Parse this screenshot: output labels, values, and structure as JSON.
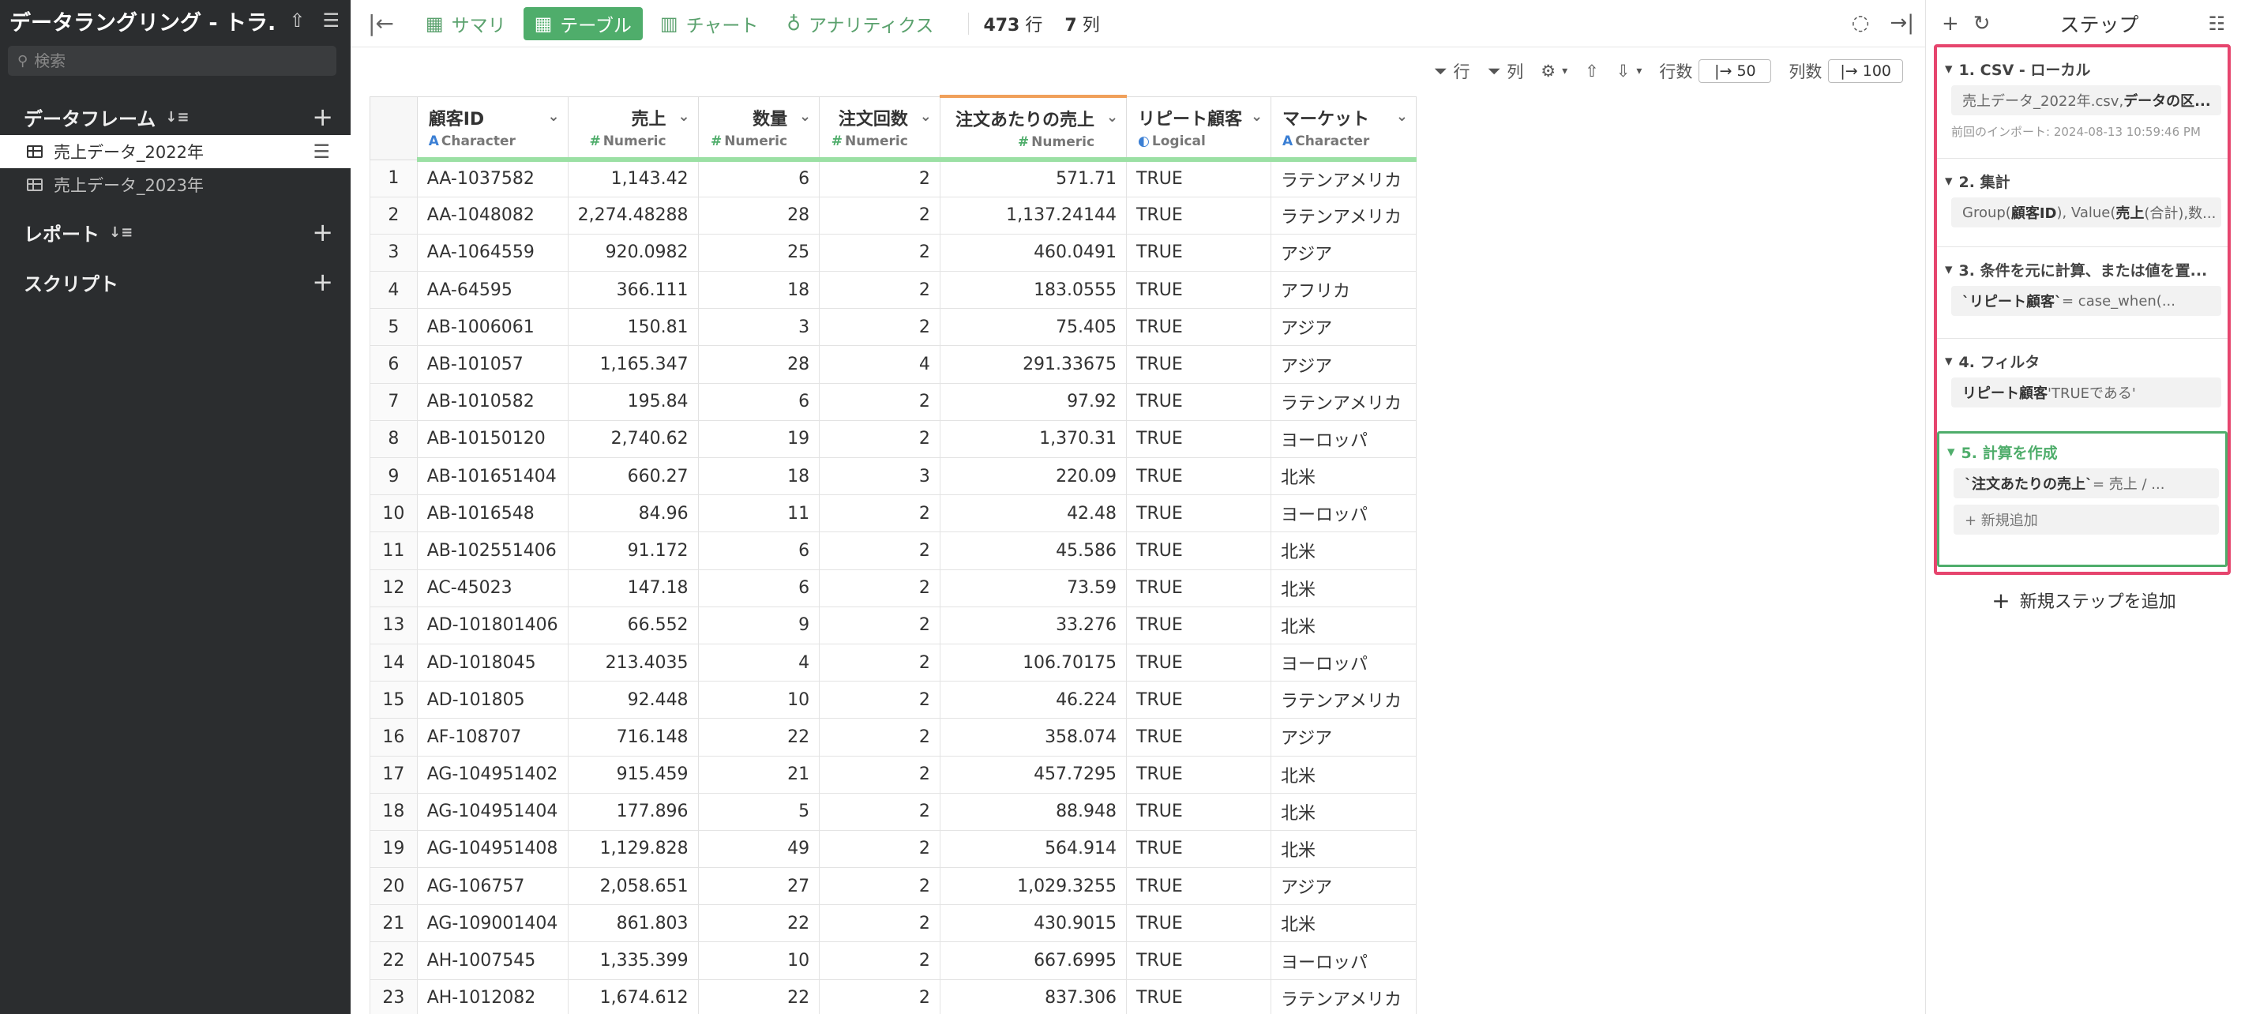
{
  "sidebar": {
    "title": "データラングリング - トラ...",
    "search_placeholder": "検索",
    "sections": {
      "dataframe": "データフレーム",
      "report": "レポート",
      "script": "スクリプト"
    },
    "dataframes": [
      "売上データ_2022年",
      "売上データ_2023年"
    ]
  },
  "toolbar": {
    "tabs": [
      "サマリ",
      "テーブル",
      "チャート",
      "アナリティクス"
    ],
    "rows_count": "473",
    "rows_unit": "行",
    "cols_count": "7",
    "cols_unit": "列"
  },
  "subbar": {
    "row_filter": "行",
    "col_filter": "列",
    "rows_label": "行数",
    "rows_value": "50",
    "cols_label": "列数",
    "cols_value": "100"
  },
  "table": {
    "columns": [
      {
        "name": "顧客ID",
        "type": "Character",
        "mark": "A"
      },
      {
        "name": "売上",
        "type": "Numeric",
        "mark": "#"
      },
      {
        "name": "数量",
        "type": "Numeric",
        "mark": "#"
      },
      {
        "name": "注文回数",
        "type": "Numeric",
        "mark": "#"
      },
      {
        "name": "注文あたりの売上",
        "type": "Numeric",
        "mark": "#"
      },
      {
        "name": "リピート顧客",
        "type": "Logical",
        "mark": "◐"
      },
      {
        "name": "マーケット",
        "type": "Character",
        "mark": "A"
      }
    ],
    "rows": [
      [
        "1",
        "AA-1037582",
        "1,143.42",
        "6",
        "2",
        "571.71",
        "TRUE",
        "ラテンアメリカ"
      ],
      [
        "2",
        "AA-1048082",
        "2,274.48288",
        "28",
        "2",
        "1,137.24144",
        "TRUE",
        "ラテンアメリカ"
      ],
      [
        "3",
        "AA-1064559",
        "920.0982",
        "25",
        "2",
        "460.0491",
        "TRUE",
        "アジア"
      ],
      [
        "4",
        "AA-64595",
        "366.111",
        "18",
        "2",
        "183.0555",
        "TRUE",
        "アフリカ"
      ],
      [
        "5",
        "AB-1006061",
        "150.81",
        "3",
        "2",
        "75.405",
        "TRUE",
        "アジア"
      ],
      [
        "6",
        "AB-101057",
        "1,165.347",
        "28",
        "4",
        "291.33675",
        "TRUE",
        "アジア"
      ],
      [
        "7",
        "AB-1010582",
        "195.84",
        "6",
        "2",
        "97.92",
        "TRUE",
        "ラテンアメリカ"
      ],
      [
        "8",
        "AB-10150120",
        "2,740.62",
        "19",
        "2",
        "1,370.31",
        "TRUE",
        "ヨーロッパ"
      ],
      [
        "9",
        "AB-101651404",
        "660.27",
        "18",
        "3",
        "220.09",
        "TRUE",
        "北米"
      ],
      [
        "10",
        "AB-1016548",
        "84.96",
        "11",
        "2",
        "42.48",
        "TRUE",
        "ヨーロッパ"
      ],
      [
        "11",
        "AB-102551406",
        "91.172",
        "6",
        "2",
        "45.586",
        "TRUE",
        "北米"
      ],
      [
        "12",
        "AC-45023",
        "147.18",
        "6",
        "2",
        "73.59",
        "TRUE",
        "北米"
      ],
      [
        "13",
        "AD-101801406",
        "66.552",
        "9",
        "2",
        "33.276",
        "TRUE",
        "北米"
      ],
      [
        "14",
        "AD-1018045",
        "213.4035",
        "4",
        "2",
        "106.70175",
        "TRUE",
        "ヨーロッパ"
      ],
      [
        "15",
        "AD-101805",
        "92.448",
        "10",
        "2",
        "46.224",
        "TRUE",
        "ラテンアメリカ"
      ],
      [
        "16",
        "AF-108707",
        "716.148",
        "22",
        "2",
        "358.074",
        "TRUE",
        "アジア"
      ],
      [
        "17",
        "AG-104951402",
        "915.459",
        "21",
        "2",
        "457.7295",
        "TRUE",
        "北米"
      ],
      [
        "18",
        "AG-104951404",
        "177.896",
        "5",
        "2",
        "88.948",
        "TRUE",
        "北米"
      ],
      [
        "19",
        "AG-104951408",
        "1,129.828",
        "49",
        "2",
        "564.914",
        "TRUE",
        "北米"
      ],
      [
        "20",
        "AG-106757",
        "2,058.651",
        "27",
        "2",
        "1,029.3255",
        "TRUE",
        "アジア"
      ],
      [
        "21",
        "AG-109001404",
        "861.803",
        "22",
        "2",
        "430.9015",
        "TRUE",
        "北米"
      ],
      [
        "22",
        "AH-1007545",
        "1,335.399",
        "10",
        "2",
        "667.6995",
        "TRUE",
        "ヨーロッパ"
      ],
      [
        "23",
        "AH-1012082",
        "1,674.612",
        "22",
        "2",
        "837.306",
        "TRUE",
        "ラテンアメリカ"
      ]
    ]
  },
  "steps": {
    "title": "ステップ",
    "items": [
      {
        "name": "1. CSV - ローカル",
        "body_plain": "売上データ_2022年.csv, ",
        "body_bold": "データの区...",
        "note": "前回のインポート: 2024-08-13 10:59:46 PM"
      },
      {
        "name": "2. 集計",
        "body_html_parts": [
          "Group(",
          "顧客ID",
          "), Value(",
          "売上",
          " (合計),数..."
        ]
      },
      {
        "name": "3. 条件を元に計算、または値を置...",
        "body_bold": "`リピート顧客`",
        "body_plain": " = case_when(..."
      },
      {
        "name": "4. フィルタ",
        "body_bold": "リピート顧客",
        "body_plain": " 'TRUEである'"
      },
      {
        "name": "5. 計算を作成",
        "body_bold": "`注文あたりの売上`",
        "body_plain": " = 売上 / ...",
        "add_label": "+ 新規追加"
      }
    ],
    "add_step": "新規ステップを追加"
  },
  "colors": {
    "accent_green": "#4fad6b",
    "highlight_pink": "#e6456e",
    "header_underline": "#9be0a4",
    "orange_indicator": "#f0a05a"
  }
}
